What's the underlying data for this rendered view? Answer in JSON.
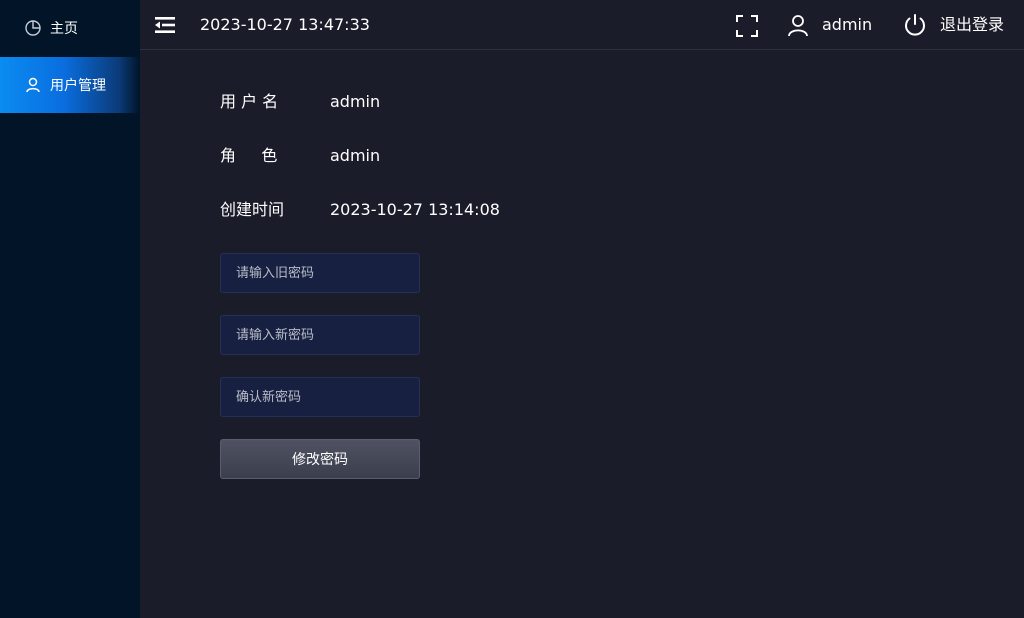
{
  "sidebar": {
    "items": [
      {
        "label": "主页",
        "icon": "pie-chart-icon",
        "active": false
      },
      {
        "label": "用户管理",
        "icon": "user-icon",
        "active": true
      }
    ]
  },
  "header": {
    "datetime": "2023-10-27 13:47:33",
    "username": "admin",
    "logout_label": "退出登录"
  },
  "profile": {
    "username_label": "用 户 名",
    "username_value": "admin",
    "role_label": "角     色",
    "role_value": "admin",
    "created_label": "创建时间",
    "created_value": "2023-10-27 13:14:08"
  },
  "form": {
    "old_password_placeholder": "请输入旧密码",
    "new_password_placeholder": "请输入新密码",
    "confirm_password_placeholder": "确认新密码",
    "submit_label": "修改密码"
  },
  "colors": {
    "sidebar_bg": "#011428",
    "main_bg": "#1b1c29",
    "active_nav": "#0a8cf0",
    "input_bg": "#172040"
  }
}
